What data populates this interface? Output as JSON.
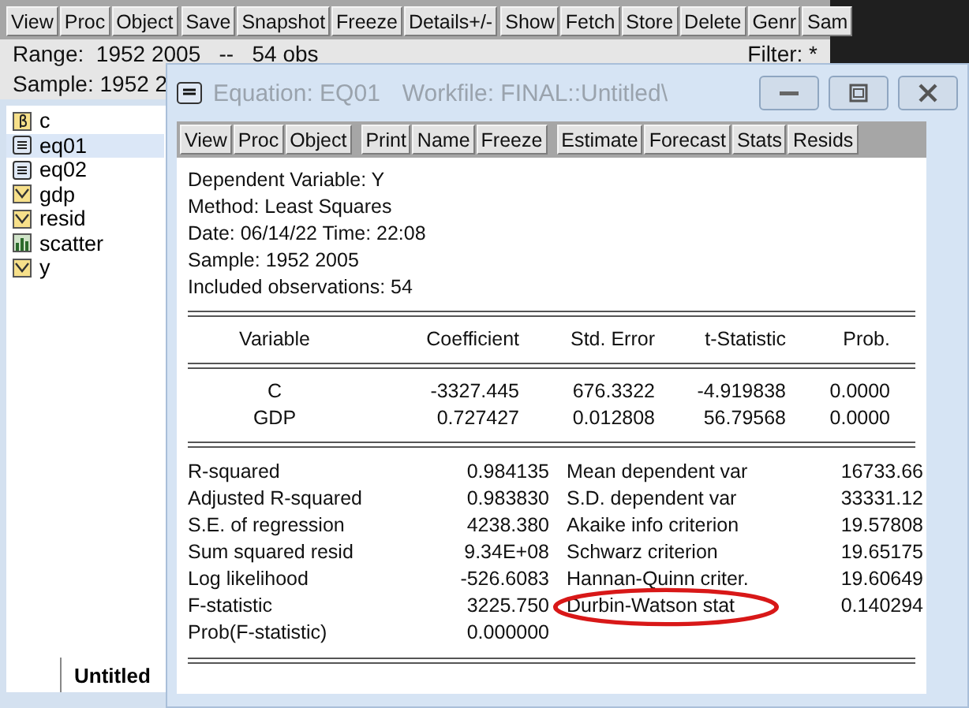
{
  "back_window": {
    "toolbar": [
      [
        "View",
        "Proc",
        "Object"
      ],
      [
        "Save",
        "Snapshot",
        "Freeze",
        "Details+/-"
      ],
      [
        "Show",
        "Fetch",
        "Store",
        "Delete",
        "Genr",
        "Sam"
      ]
    ],
    "range": "Range:  1952 2005   --   54 obs",
    "filter": "Filter: *",
    "sample": "Sample: 1952 2",
    "objects": [
      {
        "name": "c",
        "kind": "coef",
        "selected": false
      },
      {
        "name": "eq01",
        "kind": "equation",
        "selected": true
      },
      {
        "name": "eq02",
        "kind": "equation",
        "selected": false
      },
      {
        "name": "gdp",
        "kind": "series",
        "selected": false
      },
      {
        "name": "resid",
        "kind": "series",
        "selected": false
      },
      {
        "name": "scatter",
        "kind": "graph",
        "selected": false
      },
      {
        "name": "y",
        "kind": "series",
        "selected": false
      }
    ],
    "tab": "Untitled"
  },
  "equation_window": {
    "title": "Equation: EQ01",
    "workfile": "Workfile: FINAL::Untitled\\",
    "toolbar": [
      [
        "View",
        "Proc",
        "Object"
      ],
      [
        "Print",
        "Name",
        "Freeze"
      ],
      [
        "Estimate",
        "Forecast",
        "Stats",
        "Resids"
      ]
    ],
    "header_lines": [
      "Dependent Variable: Y",
      "Method: Least Squares",
      "Date: 06/14/22   Time: 22:08",
      "Sample: 1952 2005",
      "Included observations: 54"
    ],
    "columns": [
      "Variable",
      "Coefficient",
      "Std. Error",
      "t-Statistic",
      "Prob."
    ],
    "rows": [
      [
        "C",
        "-3327.445",
        "676.3322",
        "-4.919838",
        "0.0000"
      ],
      [
        "GDP",
        "0.727427",
        "0.012808",
        "56.79568",
        "0.0000"
      ]
    ],
    "stats": [
      {
        "label": "R-squared",
        "value": "0.984135",
        "label2": "Mean dependent var",
        "value2": "16733.66",
        "circled": false
      },
      {
        "label": "Adjusted R-squared",
        "value": "0.983830",
        "label2": "S.D. dependent var",
        "value2": "33331.12",
        "circled": false
      },
      {
        "label": "S.E. of regression",
        "value": "4238.380",
        "label2": "Akaike info criterion",
        "value2": "19.57808",
        "circled": false
      },
      {
        "label": "Sum squared resid",
        "value": "9.34E+08",
        "label2": "Schwarz criterion",
        "value2": "19.65175",
        "circled": false
      },
      {
        "label": "Log likelihood",
        "value": "-526.6083",
        "label2": "Hannan-Quinn criter.",
        "value2": "19.60649",
        "circled": false
      },
      {
        "label": "F-statistic",
        "value": "3225.750",
        "label2": "Durbin-Watson stat",
        "value2": "0.140294",
        "circled": true
      },
      {
        "label": "Prob(F-statistic)",
        "value": "0.000000",
        "circled": false
      }
    ]
  }
}
